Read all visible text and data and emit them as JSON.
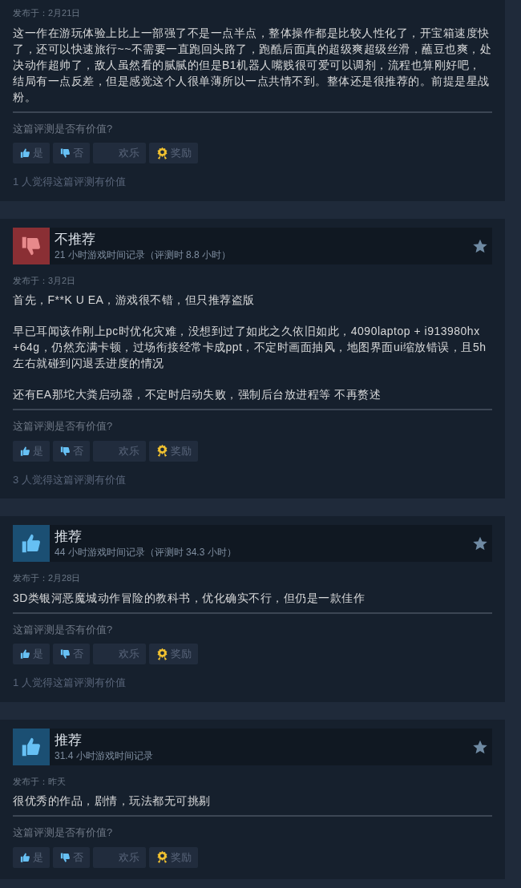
{
  "reviews": [
    {
      "date": "发布于：2月21日",
      "paragraphs": [
        "这一作在游玩体验上比上一部强了不是一点半点，整体操作都是比较人性化了，开宝箱速度快了，还可以快速旅行~~不需要一直跑回头路了，跑酷后面真的超级爽超级丝滑，蘸豆也爽，处决动作超帅了，敌人虽然看的腻腻的但是B1机器人嘴贱很可爱可以调剂，流程也算刚好吧，结局有一点反差，但是感觉这个人很单薄所以一点共情不到。整体还是很推荐的。前提是星战粉。"
      ],
      "question": "这篇评测是否有价值?",
      "buttons": [
        {
          "kind": "yes",
          "label": "是"
        },
        {
          "kind": "no",
          "label": "否"
        },
        {
          "kind": "funny",
          "label": "欢乐"
        },
        {
          "kind": "award",
          "label": "奖励"
        }
      ],
      "helpful": "1 人觉得这篇评测有价值"
    },
    {
      "verdict": {
        "kind": "not_recommended",
        "title": "不推荐",
        "hours": "21 小时游戏时间记录（评测时 8.8 小时）"
      },
      "date": "发布于：3月2日",
      "paragraphs": [
        "首先，F**K U EA，游戏很不错，但只推荐盗版",
        "早已耳闻该作刚上pc时优化灾难，没想到过了如此之久依旧如此，4090laptop + i913980hx +64g，仍然充满卡顿，过场衔接经常卡成ppt，不定时画面抽风，地图界面ui缩放错误，且5h左右就碰到闪退丢进度的情况",
        "还有EA那坨大粪启动器，不定时启动失败，强制后台放进程等 不再赘述"
      ],
      "question": "这篇评测是否有价值?",
      "buttons": [
        {
          "kind": "yes",
          "label": "是"
        },
        {
          "kind": "no",
          "label": "否"
        },
        {
          "kind": "funny",
          "label": "欢乐"
        },
        {
          "kind": "award",
          "label": "奖励"
        }
      ],
      "helpful": "3 人觉得这篇评测有价值"
    },
    {
      "verdict": {
        "kind": "recommended",
        "title": "推荐",
        "hours": "44 小时游戏时间记录（评测时 34.3 小时）"
      },
      "date": "发布于：2月28日",
      "paragraphs": [
        "3D类银河恶魔城动作冒险的教科书，优化确实不行，但仍是一款佳作"
      ],
      "question": "这篇评测是否有价值?",
      "buttons": [
        {
          "kind": "yes",
          "label": "是"
        },
        {
          "kind": "no",
          "label": "否"
        },
        {
          "kind": "funny",
          "label": "欢乐"
        },
        {
          "kind": "award",
          "label": "奖励"
        }
      ],
      "helpful": "1 人觉得这篇评测有价值"
    },
    {
      "verdict": {
        "kind": "recommended",
        "title": "推荐",
        "hours": "31.4 小时游戏时间记录"
      },
      "date": "发布于：昨天",
      "paragraphs": [
        "很优秀的作品，剧情，玩法都无可挑剔"
      ],
      "question": "这篇评测是否有价值?",
      "buttons": [
        {
          "kind": "yes",
          "label": "是"
        },
        {
          "kind": "no",
          "label": "否"
        },
        {
          "kind": "funny",
          "label": "欢乐"
        },
        {
          "kind": "award",
          "label": "奖励"
        }
      ]
    }
  ]
}
